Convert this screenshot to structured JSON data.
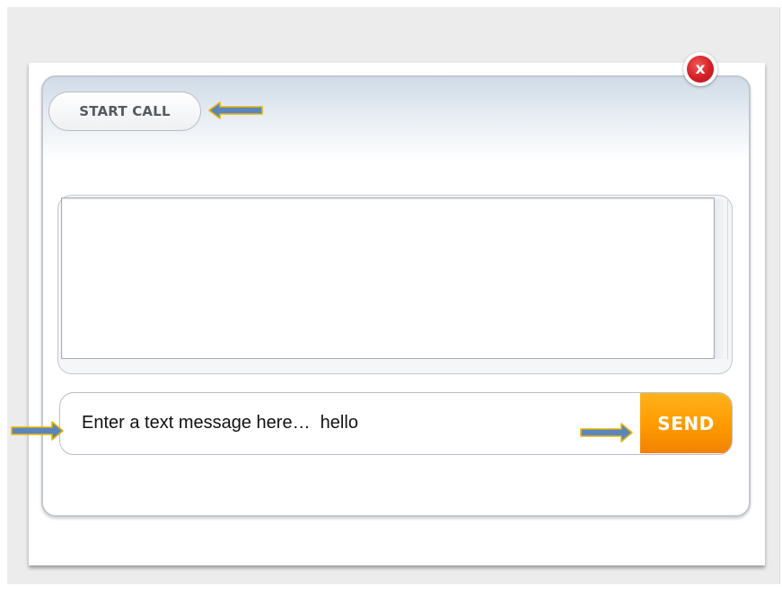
{
  "toolbar": {
    "start_call_label": "START CALL",
    "close_label": "x"
  },
  "chat": {
    "transcript_text": ""
  },
  "composer": {
    "input_value": "Enter a text message here…  hello",
    "send_label": "SEND"
  },
  "colors": {
    "accent_orange": "#ff9a00",
    "close_red": "#d41f24",
    "annotation_arrow_fill": "#5b86bd",
    "annotation_arrow_outline": "#e8b400"
  },
  "icons": {
    "close": "close-icon",
    "annotation_arrow": "arrow-icon"
  }
}
